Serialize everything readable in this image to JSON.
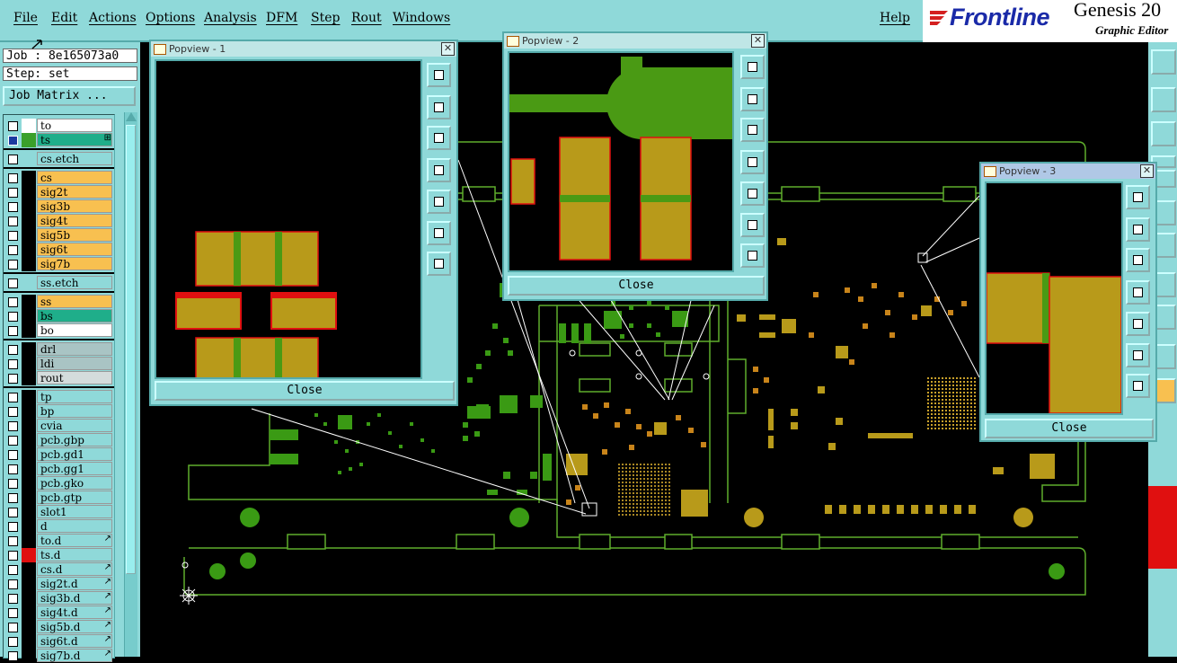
{
  "menu": {
    "file": "File",
    "edit": "Edit",
    "actions": "Actions",
    "options": "Options",
    "analysis": "Analysis",
    "dfm": "DFM",
    "step": "Step",
    "rout": "Rout",
    "windows": "Windows",
    "help": "Help"
  },
  "brand": {
    "logo": "Frontline",
    "product": "Genesis 20",
    "subtitle": "Graphic Editor"
  },
  "job": {
    "label": "Job : 8e165073a0",
    "step": "Step: set",
    "matrix_button": "Job Matrix ..."
  },
  "layers": {
    "to": "to",
    "ts": "ts",
    "cs_etch": "cs.etch",
    "cs": "cs",
    "sig2t": "sig2t",
    "sig3b": "sig3b",
    "sig4t": "sig4t",
    "sig5b": "sig5b",
    "sig6t": "sig6t",
    "sig7b": "sig7b",
    "ss_etch": "ss.etch",
    "ss": "ss",
    "bs": "bs",
    "bo": "bo",
    "drl": "drl",
    "ldi": "ldi",
    "rout": "rout",
    "tp": "tp",
    "bp": "bp",
    "cvia": "cvia",
    "pcb_gbp": "pcb.gbp",
    "pcb_gd1": "pcb.gd1",
    "pcb_gg1": "pcb.gg1",
    "pcb_gko": "pcb.gko",
    "pcb_gtp": "pcb.gtp",
    "slot1": "slot1",
    "d": "d",
    "to_d": "to.d",
    "ts_d": "ts.d",
    "cs_d": "cs.d",
    "sig2t_d": "sig2t.d",
    "sig3b_d": "sig3b.d",
    "sig4t_d": "sig4t.d",
    "sig5b_d": "sig5b.d",
    "sig6t_d": "sig6t.d",
    "sig7b_d": "sig7b.d"
  },
  "popviews": {
    "p1": {
      "title": "Popview - 1",
      "close": "Close"
    },
    "p2": {
      "title": "Popview - 2",
      "close": "Close"
    },
    "p3": {
      "title": "Popview - 3",
      "close": "Close"
    }
  },
  "colors": {
    "copper": "#b89a1a",
    "trace": "#4a9a14",
    "pad_edge": "#e01010",
    "panel": "#8fd9d9",
    "outline": "#5fae2c",
    "selected": "#1fae8a"
  }
}
